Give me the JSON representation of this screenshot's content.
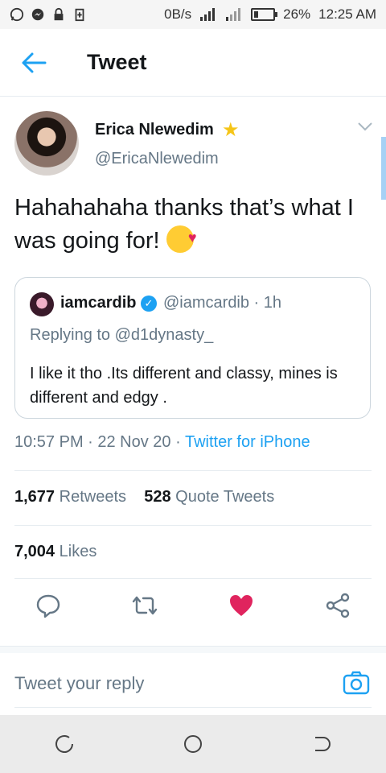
{
  "status_bar": {
    "network_speed": "0B/s",
    "battery_percent": "26%",
    "time": "12:25 AM"
  },
  "header": {
    "title": "Tweet"
  },
  "tweet": {
    "author_name": "Erica Nlewedim",
    "author_handle": "@EricaNlewedim",
    "text": "Hahahahaha thanks that’s what I was going for!",
    "timestamp": "10:57 PM · 22 Nov 20 · ",
    "source": "Twitter for iPhone"
  },
  "quoted_tweet": {
    "author_name": "iamcardib",
    "author_handle": "@iamcardib · 1h",
    "replying_to": "Replying to @d1dynasty_",
    "text": "I like it tho .Its different and classy, mines is different and edgy ."
  },
  "stats": {
    "retweets_count": "1,677",
    "retweets_label": "Retweets",
    "quotes_count": "528",
    "quotes_label": "Quote Tweets",
    "likes_count": "7,004",
    "likes_label": "Likes"
  },
  "reply": {
    "placeholder": "Tweet your reply"
  },
  "colors": {
    "accent": "#1da1f2",
    "like": "#e0245e",
    "muted": "#657786"
  }
}
